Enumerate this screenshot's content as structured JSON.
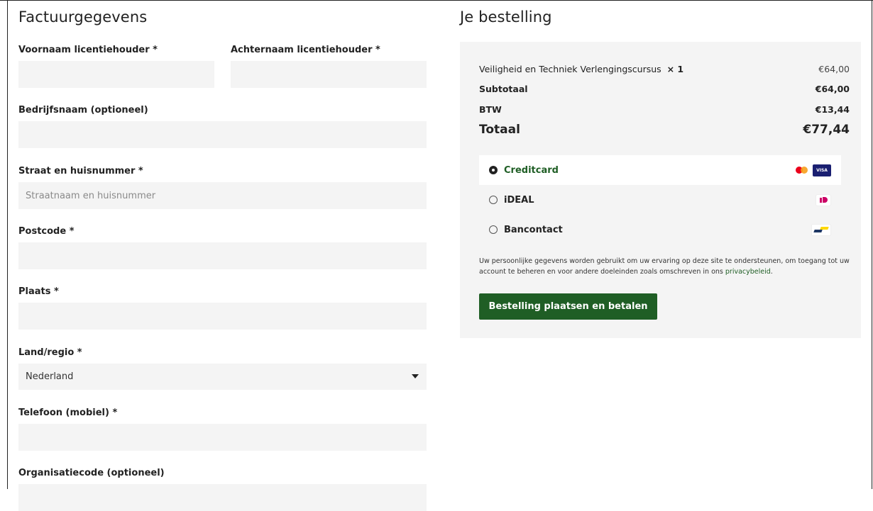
{
  "billing": {
    "title": "Factuurgegevens",
    "first_name_label": "Voornaam licentiehouder *",
    "last_name_label": "Achternaam licentiehouder *",
    "company_label": "Bedrijfsnaam (optioneel)",
    "street_label": "Straat en huisnummer *",
    "street_placeholder": "Straatnaam en huisnummer",
    "postcode_label": "Postcode *",
    "city_label": "Plaats *",
    "country_label": "Land/regio *",
    "country_value": "Nederland",
    "phone_label": "Telefoon (mobiel) *",
    "org_label": "Organisatiecode (optioneel)"
  },
  "order": {
    "title": "Je bestelling",
    "item_name": "Veiligheid en Techniek Verlengingscursus",
    "item_qty": "× 1",
    "item_price": "€64,00",
    "subtotal_label": "Subtotaal",
    "subtotal_value": "€64,00",
    "vat_label": "BTW",
    "vat_value": "€13,44",
    "total_label": "Totaal",
    "total_value": "€77,44"
  },
  "payment": {
    "methods": [
      {
        "label": "Creditcard",
        "selected": true,
        "icons": [
          "mastercard-icon",
          "visa-icon"
        ]
      },
      {
        "label": "iDEAL",
        "selected": false,
        "icons": [
          "ideal-icon"
        ]
      },
      {
        "label": "Bancontact",
        "selected": false,
        "icons": [
          "bancontact-icon"
        ]
      }
    ],
    "visa_text": "VISA"
  },
  "privacy": {
    "text": "Uw persoonlijke gegevens worden gebruikt om uw ervaring op deze site te ondersteunen, om toegang tot uw account te beheren en voor andere doeleinden zoals omschreven in ons ",
    "link": "privacybeleid",
    "end": "."
  },
  "submit_label": "Bestelling plaatsen en betalen",
  "colors": {
    "accent": "#1f5e25",
    "field_bg": "#f4f4f4",
    "box_bg": "#f4f4f4"
  }
}
